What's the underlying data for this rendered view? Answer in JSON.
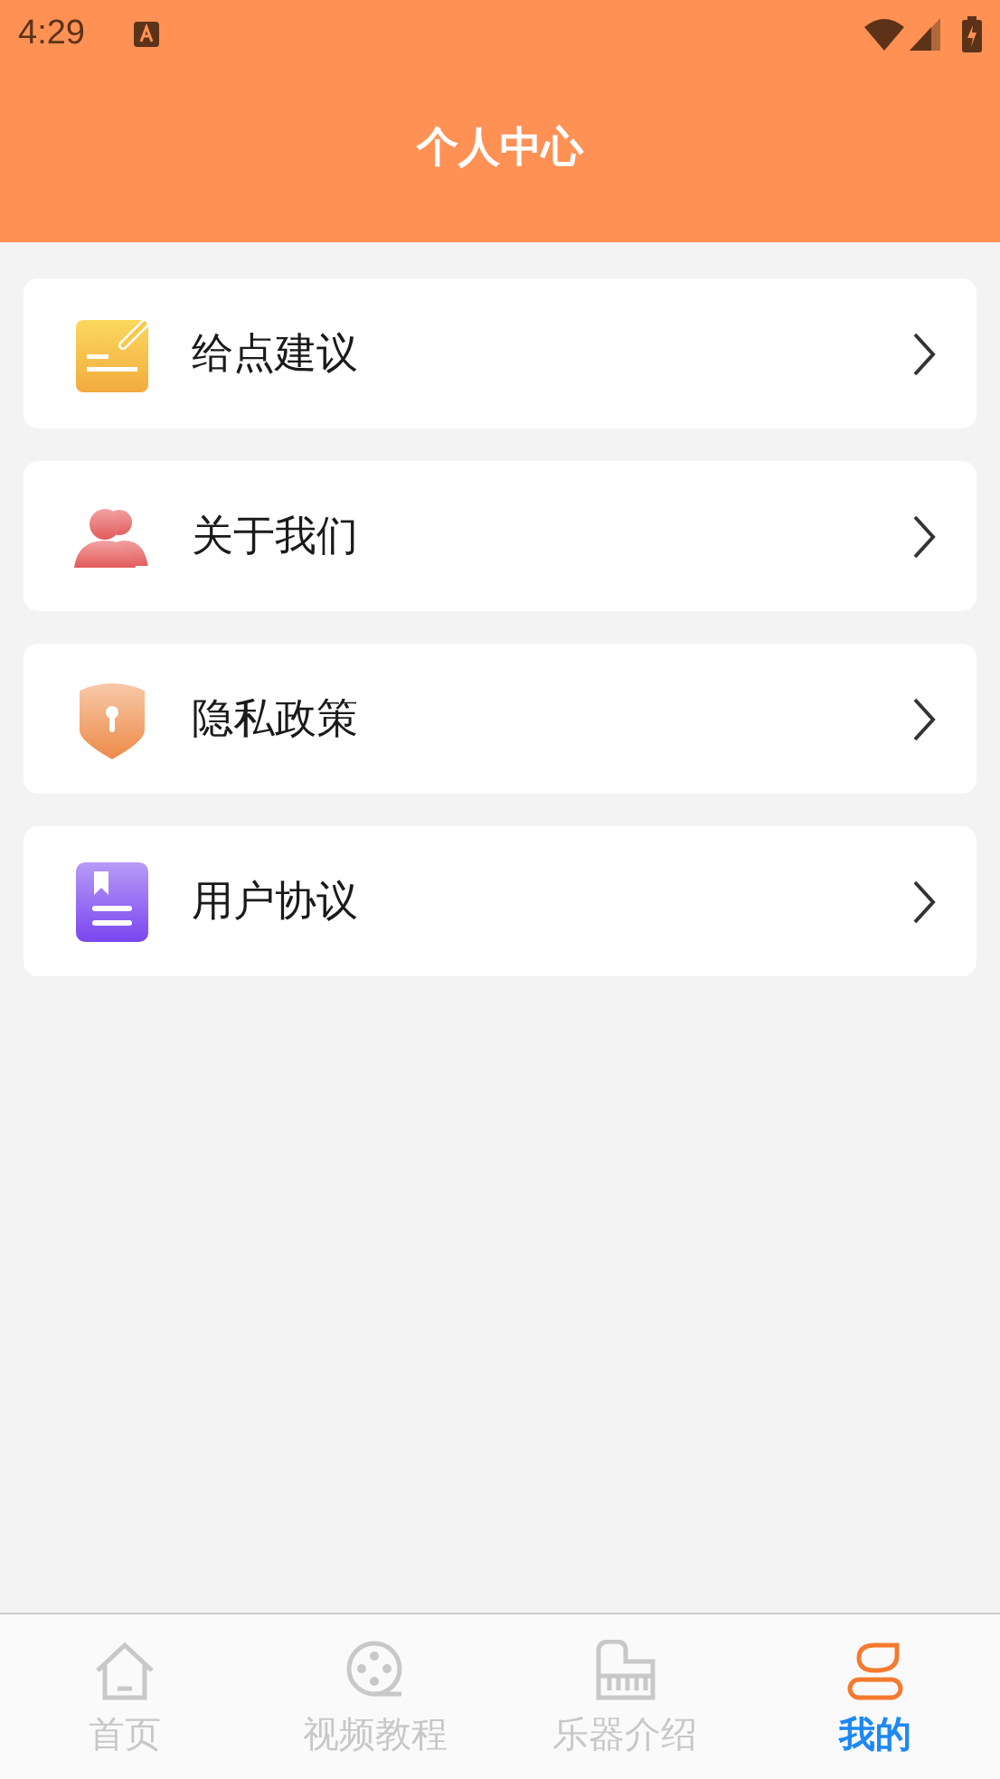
{
  "status_bar": {
    "time": "4:29"
  },
  "header": {
    "title": "个人中心"
  },
  "menu": [
    {
      "label": "给点建议",
      "kind": "note"
    },
    {
      "label": "关于我们",
      "kind": "people"
    },
    {
      "label": "隐私政策",
      "kind": "shield"
    },
    {
      "label": "用户协议",
      "kind": "document"
    }
  ],
  "tab_bar": [
    {
      "label": "首页",
      "kind": "home",
      "selected": false
    },
    {
      "label": "视频教程",
      "kind": "film",
      "selected": false
    },
    {
      "label": "乐器介绍",
      "kind": "piano",
      "selected": false
    },
    {
      "label": "我的",
      "kind": "user",
      "selected": true
    }
  ]
}
